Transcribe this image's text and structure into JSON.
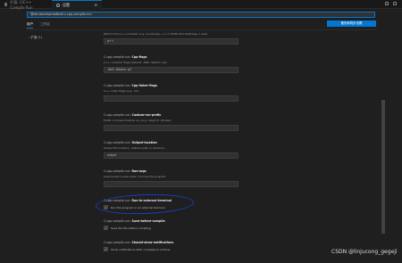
{
  "tabs": [
    {
      "label": "扩展: C/C++ Compile Run"
    },
    {
      "label": "设置"
    }
  ],
  "search": {
    "value": "@ext:danielpinto8zz6.c-cpp-compile-run"
  },
  "sync_button": "备份和同步设置",
  "scopes": [
    "用户",
    "工作区"
  ],
  "tree": {
    "item": "扩展 (1)"
  },
  "top_desc": "Path to the C++ compiler (e.g. /usr/bin/g++ or C:\\TDM-GCC-64\\bin\\g++.exe)",
  "settings": [
    {
      "prefix": "",
      "bold": "",
      "desc": "",
      "kind": "input",
      "value": "g++"
    },
    {
      "prefix": "C-cpp-compile-run: ",
      "bold": "Cpp-flags",
      "desc": "C++ compiler flags (default: -Wall -Wextra -g3)",
      "kind": "input",
      "value": "-Wall -Wextra -g3"
    },
    {
      "prefix": "C-cpp-compile-run: ",
      "bold": "Cpp-linker-flags",
      "desc": "C++ linker flags (e.g. -lm)",
      "kind": "input",
      "value": ""
    },
    {
      "prefix": "C-cpp-compile-run: ",
      "bold": "Custom-run-prefix",
      "desc": "Prefix command before run (e.g. valgrind ./foobar)",
      "kind": "input",
      "value": ""
    },
    {
      "prefix": "C-cpp-compile-run: ",
      "bold": "Output-location",
      "desc": "Output file location, relative path or directory.",
      "kind": "input",
      "value": "output"
    },
    {
      "prefix": "C-cpp-compile-run: ",
      "bold": "Run-args",
      "desc": "Arguments to pass when running the program",
      "kind": "input",
      "value": ""
    },
    {
      "prefix": "C-cpp-compile-run: ",
      "bold": "Run-in-external-terminal",
      "desc": "",
      "kind": "check",
      "checked": true,
      "label": "Run the program in an external terminal"
    },
    {
      "prefix": "C-cpp-compile-run: ",
      "bold": "Save-before-compile",
      "desc": "",
      "kind": "check",
      "checked": true,
      "label": "Save the file before compiling"
    },
    {
      "prefix": "C-cpp-compile-run: ",
      "bold": "Should-show-notifications",
      "desc": "",
      "kind": "check",
      "checked": true,
      "label": "Show notifications after compile/run actions"
    }
  ],
  "watermark": "CSDN @linjucong_gegeji"
}
